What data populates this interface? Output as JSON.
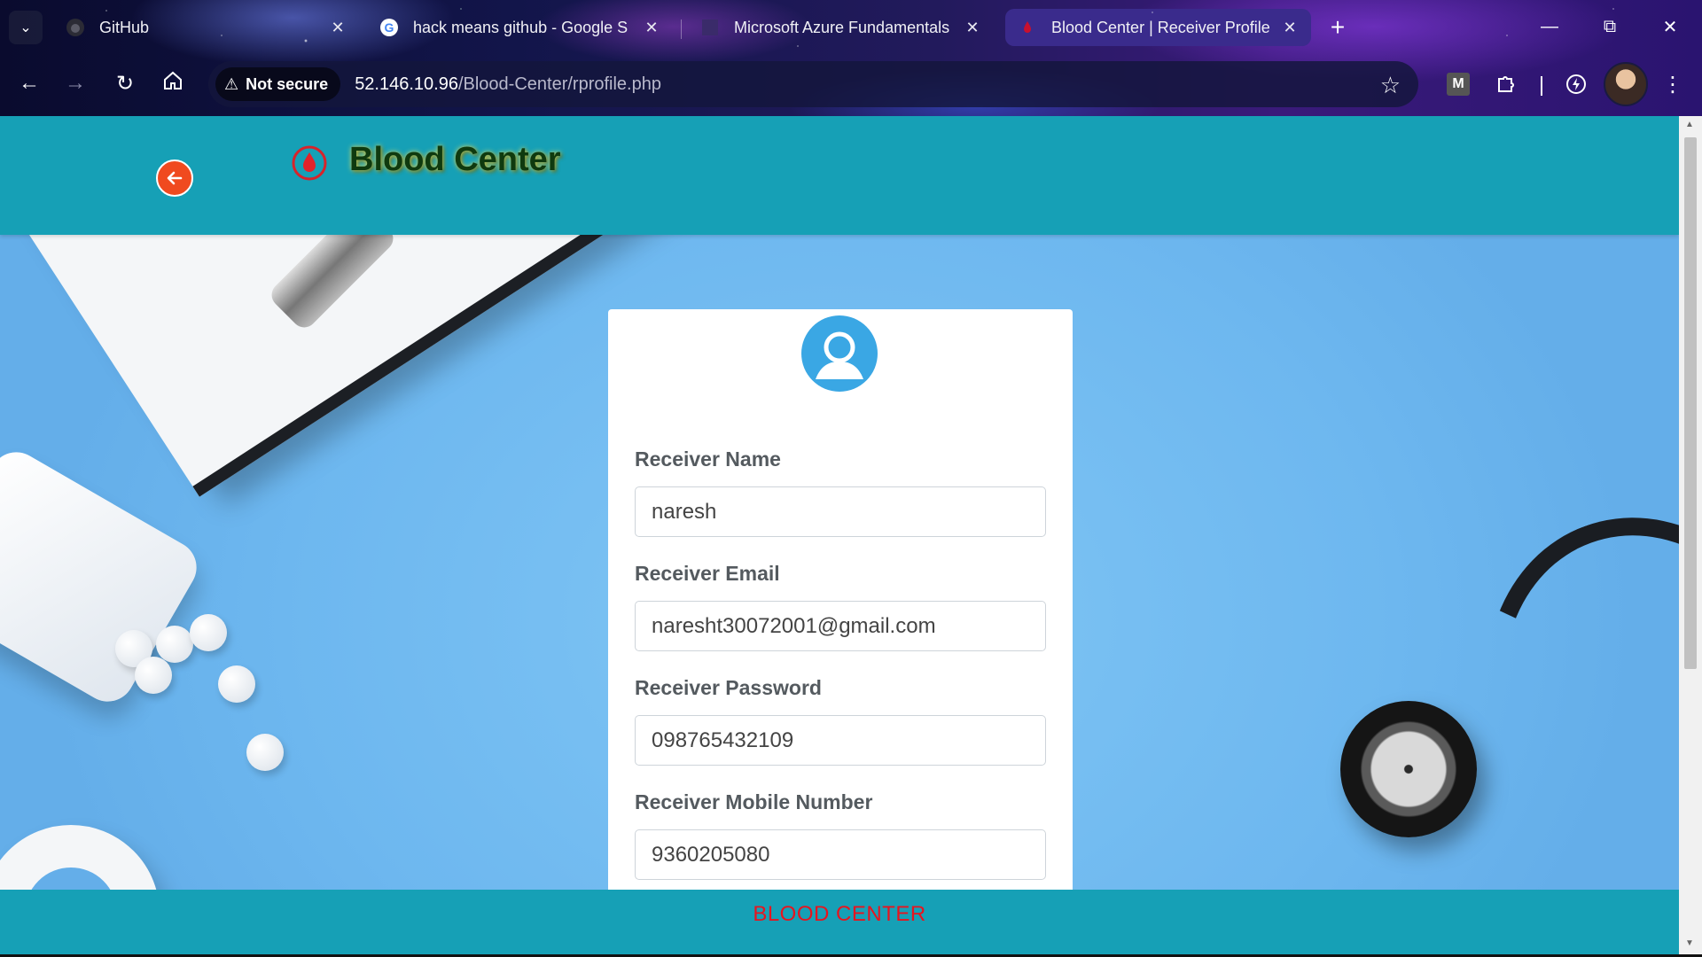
{
  "browser": {
    "tabs": [
      {
        "title": "GitHub",
        "icon": "github-icon",
        "active": false
      },
      {
        "title": "hack means github - Google S",
        "icon": "google-icon",
        "active": false
      },
      {
        "title": "Microsoft Azure Fundamentals",
        "icon": "azure-icon",
        "active": false
      },
      {
        "title": "Blood Center | Receiver Profile",
        "icon": "blood-drop-icon",
        "active": true
      }
    ],
    "security_label": "Not secure",
    "url_host": "52.146.10.96",
    "url_path": "/Blood-Center/rprofile.php",
    "extensions": [
      "m-extension-icon",
      "puzzle-extension-icon",
      "speed-extension-icon"
    ]
  },
  "site": {
    "brand": "Blood Center",
    "footer": "BLOOD CENTER",
    "colors": {
      "header": "#16a0b6",
      "back_button": "#f04a1f",
      "footer_text": "#e8141e"
    }
  },
  "profile": {
    "fields": [
      {
        "label": "Receiver Name",
        "value": "naresh"
      },
      {
        "label": "Receiver Email",
        "value": "naresht30072001@gmail.com"
      },
      {
        "label": "Receiver Password",
        "value": "098765432109"
      },
      {
        "label": "Receiver Mobile Number",
        "value": "9360205080"
      }
    ]
  }
}
